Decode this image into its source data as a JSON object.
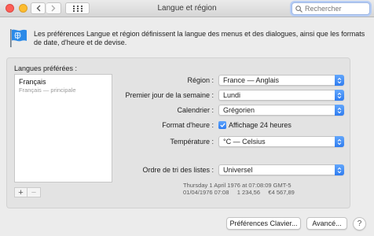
{
  "window": {
    "title": "Langue et région"
  },
  "search": {
    "placeholder": "Rechercher",
    "value": ""
  },
  "header": {
    "description": "Les préférences Langue et région définissent la langue des menus et des dialogues, ainsi que les formats de date, d'heure et de devise."
  },
  "languages": {
    "label": "Langues préférées :",
    "items": [
      {
        "name": "Français",
        "subtitle": "Français — principale"
      }
    ],
    "add_label": "+",
    "remove_label": "−"
  },
  "settings": {
    "region": {
      "label": "Région :",
      "value": "France — Anglais"
    },
    "first_day": {
      "label": "Premier jour de la semaine :",
      "value": "Lundi"
    },
    "calendar": {
      "label": "Calendrier :",
      "value": "Grégorien"
    },
    "time_format": {
      "label": "Format d'heure :",
      "checkbox_label": "Affichage 24 heures",
      "checked": true
    },
    "temperature": {
      "label": "Température :",
      "value": "°C — Celsius"
    },
    "sort_order": {
      "label": "Ordre de tri des listes :",
      "value": "Universel"
    }
  },
  "sample": {
    "line1": "Thursday 1 April 1976 at 07:08:09 GMT-5",
    "line2": "01/04/1976 07:08     1 234,56     €4 567,89"
  },
  "buttons": {
    "keyboard_prefs": "Préférences Clavier...",
    "advanced": "Avancé...",
    "help": "?"
  },
  "colors": {
    "accent": "#2f7cf0",
    "close": "#fc5f57",
    "minimize": "#fdbc2e"
  }
}
